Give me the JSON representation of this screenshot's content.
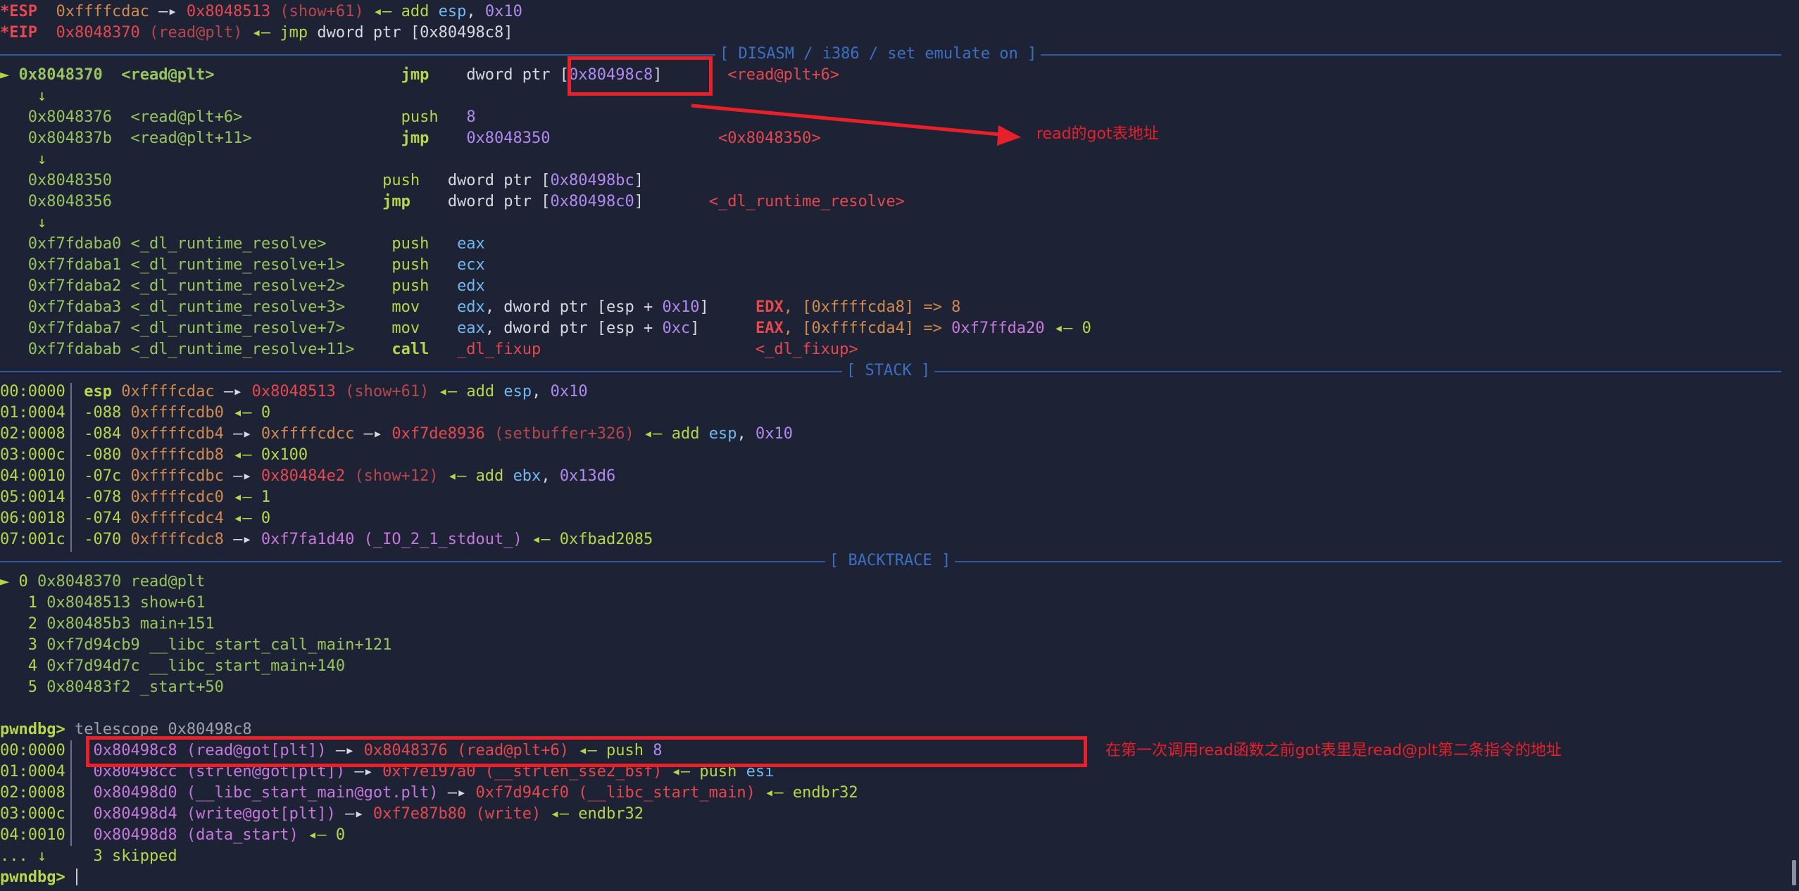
{
  "registers": {
    "esp": {
      "name": "*ESP",
      "addr": "0xffffcdac",
      "arrow": " —▸ ",
      "target": "0x8048513",
      "sym": "(show+61)",
      "back": " ◂— ",
      "ins": "add",
      "op1": "esp",
      "op2": "0x10"
    },
    "eip": {
      "name": "*EIP",
      "addr": "0x8048370",
      "sym": "(read@plt)",
      "back": " ◂— ",
      "ins": "jmp",
      "op": "dword ptr [0x80498c8]"
    }
  },
  "separators": {
    "disasm": "[ DISASM / i386 / set emulate on ]",
    "stack": "[ STACK ]",
    "backtrace": "[ BACKTRACE ]"
  },
  "disasm": [
    {
      "marker": "►",
      "addr": "0x8048370",
      "sym": "<read@plt>",
      "ins": "jmp",
      "ops": [
        "dword ptr [",
        "0x80498c8",
        "]"
      ],
      "cmt": "<read@plt+6>"
    },
    {
      "marker": "↓"
    },
    {
      "addr": "0x8048376",
      "sym": "<read@plt+6>",
      "ins": "push",
      "imm": "8"
    },
    {
      "addr": "0x804837b",
      "sym": "<read@plt+11>",
      "ins": "jmp",
      "imm": "0x8048350",
      "cmt": "<0x8048350>"
    },
    {
      "marker": "↓"
    },
    {
      "addr": "0x8048350",
      "sym": "",
      "ins": "push",
      "ops": [
        "dword ptr [",
        "0x80498bc",
        "]"
      ]
    },
    {
      "addr": "0x8048356",
      "sym": "",
      "ins": "jmp",
      "ops": [
        "dword ptr [",
        "0x80498c0",
        "]"
      ],
      "cmt": "<_dl_runtime_resolve>"
    },
    {
      "marker": "↓"
    },
    {
      "addr": "0xf7fdaba0",
      "sym": "<_dl_runtime_resolve>",
      "ins": "push",
      "reg": "eax"
    },
    {
      "addr": "0xf7fdaba1",
      "sym": "<_dl_runtime_resolve+1>",
      "ins": "push",
      "reg": "ecx"
    },
    {
      "addr": "0xf7fdaba2",
      "sym": "<_dl_runtime_resolve+2>",
      "ins": "push",
      "reg": "edx"
    },
    {
      "addr": "0xf7fdaba3",
      "sym": "<_dl_runtime_resolve+3>",
      "ins": "mov",
      "reg": "edx",
      "ops": [
        ", dword ptr [esp + ",
        "0x10",
        "]"
      ],
      "creg": "EDX",
      "cval": ", [0xffffcda8] => 8"
    },
    {
      "addr": "0xf7fdaba7",
      "sym": "<_dl_runtime_resolve+7>",
      "ins": "mov",
      "reg": "eax",
      "ops": [
        ", dword ptr [esp + ",
        "0xc",
        "]"
      ],
      "creg": "EAX",
      "cval": ", [0xffffcda4] => ",
      "cptr": "0xf7ffda20",
      "ctail": " ◂— 0"
    },
    {
      "addr": "0xf7fdabab",
      "sym": "<_dl_runtime_resolve+11>",
      "ins": "call",
      "imm": "_dl_fixup",
      "cmt": "<_dl_fixup>"
    }
  ],
  "stack": [
    {
      "idx": "00:0000",
      "off": "esp",
      "addr": "0xffffcdac",
      "a": " —▸ ",
      "v1": "0x8048513",
      "v1s": "(show+61)",
      "b": " ◂— ",
      "ins": "add",
      "op1": "esp",
      "op2": "0x10"
    },
    {
      "idx": "01:0004",
      "off": "-088",
      "addr": "0xffffcdb0",
      "b": " ◂— ",
      "val": "0"
    },
    {
      "idx": "02:0008",
      "off": "-084",
      "addr": "0xffffcdb4",
      "a": " —▸ ",
      "v0": "0xffffcdcc",
      "a2": " —▸ ",
      "v1": "0xf7de8936",
      "v1s": "(setbuffer+326)",
      "b": " ◂— ",
      "ins": "add",
      "op1": "esp",
      "op2": "0x10"
    },
    {
      "idx": "03:000c",
      "off": "-080",
      "addr": "0xffffcdb8",
      "b": " ◂— ",
      "val": "0x100"
    },
    {
      "idx": "04:0010",
      "off": "-07c",
      "addr": "0xffffcdbc",
      "a": " —▸ ",
      "v1": "0x80484e2",
      "v1s": "(show+12)",
      "b": " ◂— ",
      "ins": "add",
      "op1": "ebx",
      "op2": "0x13d6"
    },
    {
      "idx": "05:0014",
      "off": "-078",
      "addr": "0xffffcdc0",
      "b": " ◂— ",
      "val": "1"
    },
    {
      "idx": "06:0018",
      "off": "-074",
      "addr": "0xffffcdc4",
      "b": " ◂— ",
      "val": "0"
    },
    {
      "idx": "07:001c",
      "off": "-070",
      "addr": "0xffffcdc8",
      "a": " —▸ ",
      "pv": "0xf7fa1d40 (_IO_2_1_stdout_)",
      "b": " ◂— ",
      "val": "0xfbad2085"
    }
  ],
  "backtrace": [
    {
      "marker": "►",
      "n": "0",
      "addr": "0x8048370",
      "sym": "read@plt"
    },
    {
      "n": "1",
      "addr": "0x8048513",
      "sym": "show+61"
    },
    {
      "n": "2",
      "addr": "0x80485b3",
      "sym": "main+151"
    },
    {
      "n": "3",
      "addr": "0xf7d94cb9",
      "sym": "__libc_start_call_main+121"
    },
    {
      "n": "4",
      "addr": "0xf7d94d7c",
      "sym": "__libc_start_main+140"
    },
    {
      "n": "5",
      "addr": "0x80483f2",
      "sym": "_start+50"
    }
  ],
  "telescope": {
    "prompt": "pwndbg>",
    "command": "telescope 0x80498c8",
    "rows": [
      {
        "idx": "00:0000",
        "p": "0x80498c8 (read@got[plt])",
        "a": " —▸ ",
        "v": "0x8048376 (read@plt+6)",
        "b": " ◂— ",
        "ins": "push",
        "op": "8"
      },
      {
        "idx": "01:0004",
        "p": "0x80498cc (strlen@got[plt])",
        "a": " —▸ ",
        "v": "0xf7e197a0 (__strlen_sse2_bsf)",
        "b": " ◂— ",
        "ins": "push",
        "op": "esi"
      },
      {
        "idx": "02:0008",
        "p": "0x80498d0 (__libc_start_main@got.plt)",
        "a": " —▸ ",
        "v": "0xf7d94cf0 (__libc_start_main)",
        "b": " ◂— ",
        "ins": "endbr32",
        "op": ""
      },
      {
        "idx": "03:000c",
        "p": "0x80498d4 (write@got[plt])",
        "a": " —▸ ",
        "v": "0xf7e87b80 (write)",
        "b": " ◂— ",
        "ins": "endbr32",
        "op": ""
      },
      {
        "idx": "04:0010",
        "p": "0x80498d8 (data_start)",
        "b": " ◂— ",
        "val": "0"
      }
    ],
    "skipped_prefix": "... ↓",
    "skipped_text": "3 skipped",
    "final_prompt": "pwndbg>"
  },
  "annotations": {
    "got_note": "read的got表地址",
    "telescope_note": "在第一次调用read函数之前got表里是read@plt第二条指令的地址"
  },
  "colors": {
    "background": "#1e2235",
    "accent_red": "#e8202a",
    "separator": "#2d5a9e"
  }
}
